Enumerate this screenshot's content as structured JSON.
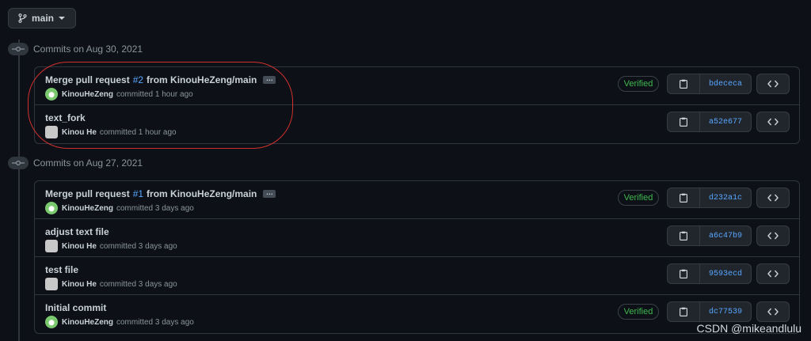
{
  "branch": {
    "label": "main"
  },
  "groups": [
    {
      "header": "Commits on Aug 30, 2021",
      "commits": [
        {
          "msg_prefix": "Merge pull request",
          "pr": "#2",
          "msg_suffix": "from KinouHeZeng/main",
          "author": "KinouHeZeng",
          "time": "committed 1 hour ago",
          "verified": "Verified",
          "sha": "bdececa"
        },
        {
          "msg": "text_fork",
          "author": "Kinou He",
          "time": "committed 1 hour ago",
          "sha": "a52e677"
        }
      ]
    },
    {
      "header": "Commits on Aug 27, 2021",
      "commits": [
        {
          "msg_prefix": "Merge pull request",
          "pr": "#1",
          "msg_suffix": "from KinouHeZeng/main",
          "author": "KinouHeZeng",
          "time": "committed 3 days ago",
          "verified": "Verified",
          "sha": "d232a1c"
        },
        {
          "msg": "adjust text file",
          "author": "Kinou He",
          "time": "committed 3 days ago",
          "sha": "a6c47b9"
        },
        {
          "msg": "test file",
          "author": "Kinou He",
          "time": "committed 3 days ago",
          "sha": "9593ecd"
        },
        {
          "msg": "Initial commit",
          "author": "KinouHeZeng",
          "time": "committed 3 days ago",
          "verified": "Verified",
          "sha": "dc77539"
        }
      ]
    }
  ],
  "watermark": "CSDN @mikeandlulu",
  "colors": {
    "background": "#0d1117",
    "link": "#58a6ff",
    "verified": "#3fb950",
    "annotation": "#d0312d"
  },
  "icons": {
    "branch": "git-branch-icon",
    "commit": "git-commit-icon",
    "copy": "clipboard-icon",
    "browse": "code-icon"
  }
}
